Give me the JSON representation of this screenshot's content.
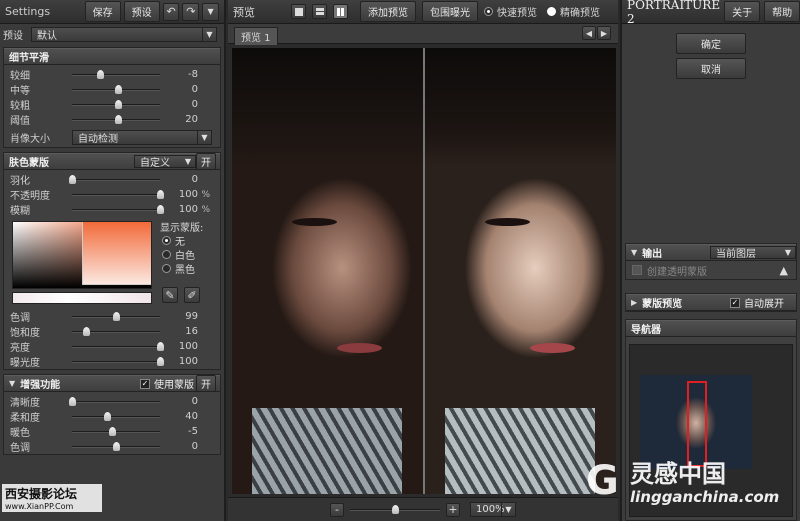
{
  "left": {
    "toolbar": {
      "title": "Settings",
      "save": "保存",
      "preset": "预设",
      "undo_icon": "undo-icon",
      "redo_icon": "redo-icon"
    },
    "preset_row": {
      "label": "预设",
      "value": "默认"
    },
    "detail_smoothing": {
      "title": "细节平滑",
      "sliders": [
        {
          "label": "较细",
          "value": "-8",
          "pos": 0.32
        },
        {
          "label": "中等",
          "value": "0",
          "pos": 0.52
        },
        {
          "label": "较粗",
          "value": "0",
          "pos": 0.52
        },
        {
          "label": "阈值",
          "value": "20",
          "pos": 0.52
        }
      ],
      "portrait_size": {
        "label": "肖像大小",
        "value": "自动检测"
      }
    },
    "skin_mask": {
      "title": "肤色蒙版",
      "mode": "自定义",
      "toggle": "开",
      "sliders": [
        {
          "label": "羽化",
          "value": "0",
          "pct": "",
          "pos": 0.0
        },
        {
          "label": "不透明度",
          "value": "100",
          "pct": "%",
          "pos": 1.0
        },
        {
          "label": "模糊",
          "value": "100",
          "pct": "%",
          "pos": 1.0
        }
      ],
      "show_mask_label": "显示蒙版:",
      "show_mask_options": [
        {
          "label": "无",
          "selected": true
        },
        {
          "label": "白色",
          "selected": false
        },
        {
          "label": "黑色",
          "selected": false
        }
      ],
      "color_sliders": [
        {
          "label": "色调",
          "value": "99",
          "pos": 0.5
        },
        {
          "label": "饱和度",
          "value": "16",
          "pos": 0.16
        },
        {
          "label": "亮度",
          "value": "100",
          "pos": 1.0
        },
        {
          "label": "曝光度",
          "value": "100",
          "pos": 1.0
        }
      ]
    },
    "enhancements": {
      "title": "增强功能",
      "use_mask_label": "使用蒙版",
      "use_mask_checked": true,
      "toggle": "开",
      "sliders": [
        {
          "label": "清晰度",
          "value": "0",
          "pos": 0.0
        },
        {
          "label": "柔和度",
          "value": "40",
          "pos": 0.4
        },
        {
          "label": "暖色",
          "value": "-5",
          "pos": 0.45
        },
        {
          "label": "色调",
          "value": "0",
          "pos": 0.5
        }
      ]
    },
    "watermark": {
      "title": "西安摄影论坛",
      "url": "www.XianPP.Com"
    }
  },
  "center": {
    "toolbar": {
      "title": "预览",
      "add_preview": "添加预览",
      "clip_exposure": "包围曝光",
      "quick_preview": "快速预览",
      "accurate_preview": "精确预览",
      "quick_selected": true
    },
    "tab": "预览 1",
    "bottom": {
      "minus": "-",
      "plus": "+",
      "zoom": "100%",
      "zoom_pos": 0.5
    }
  },
  "right": {
    "toolbar": {
      "title": "PORTRAITURE 2",
      "about": "关于",
      "help": "帮助"
    },
    "ok": "确定",
    "cancel": "取消",
    "output": {
      "label": "输出",
      "value": "当前图层",
      "create_mask": "创建透明蒙版",
      "warn_icon": "warning-icon"
    },
    "mask_preview": {
      "label": "蒙版预览",
      "auto_expand": "自动展开",
      "auto_checked": true
    },
    "navigator": {
      "title": "导航器"
    },
    "watermark": {
      "cn": "灵感中国",
      "url": "lingganchina.com"
    }
  },
  "colors": {
    "panel": "#3a3a3a",
    "highlight": "#e04a20",
    "nav_frame": "#e02020"
  }
}
